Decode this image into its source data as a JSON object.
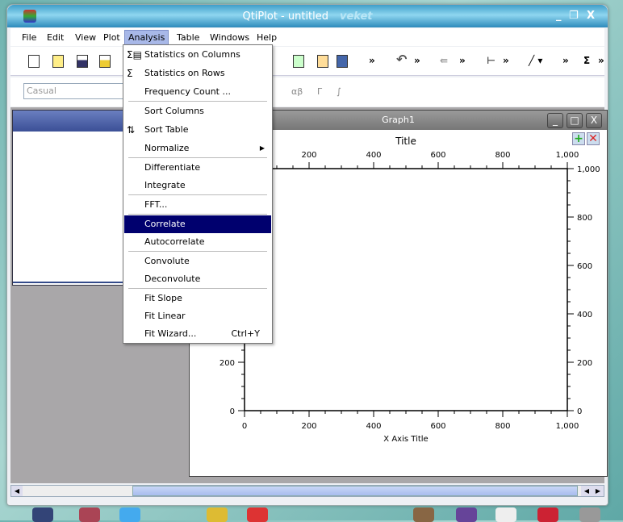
{
  "window": {
    "title": "QtiPlot - untitled",
    "watermark": "veket",
    "minimize": "_",
    "restore": "❐",
    "close": "X"
  },
  "menubar": [
    "File",
    "Edit",
    "View",
    "Plot",
    "Analysis",
    "Table",
    "Windows",
    "Help"
  ],
  "menubar_active": "Analysis",
  "format_toolbar": {
    "font": "Casual",
    "glyphs": [
      "αβ",
      "Γ",
      "∫"
    ]
  },
  "analysis_menu": {
    "items": [
      {
        "label": "Statistics on Columns",
        "icon": "sigma-columns-icon"
      },
      {
        "label": "Statistics on Rows",
        "icon": "sigma-rows-icon"
      },
      {
        "label": "Frequency Count ..."
      },
      {
        "label": "Sort Columns"
      },
      {
        "label": "Sort Table",
        "icon": "sort-az-icon"
      },
      {
        "label": "Normalize",
        "submenu": true
      },
      {
        "label": "Differentiate"
      },
      {
        "label": "Integrate"
      },
      {
        "label": "FFT..."
      },
      {
        "label": "Correlate",
        "highlighted": true
      },
      {
        "label": "Autocorrelate"
      },
      {
        "label": "Convolute"
      },
      {
        "label": "Deconvolute"
      },
      {
        "label": "Fit Slope"
      },
      {
        "label": "Fit Linear"
      },
      {
        "label": "Fit Wizard...",
        "shortcut": "Ctrl+Y"
      }
    ]
  },
  "graph": {
    "title": "Graph1",
    "plot_title": "Title",
    "x_axis_title": "X Axis Title",
    "x_ticks": [
      "0",
      "200",
      "400",
      "600",
      "800",
      "1,000"
    ],
    "y_ticks": [
      "0",
      "200",
      "400",
      "600",
      "800",
      "1,000"
    ],
    "xlim": [
      0,
      1000
    ],
    "ylim": [
      0,
      1000
    ]
  }
}
